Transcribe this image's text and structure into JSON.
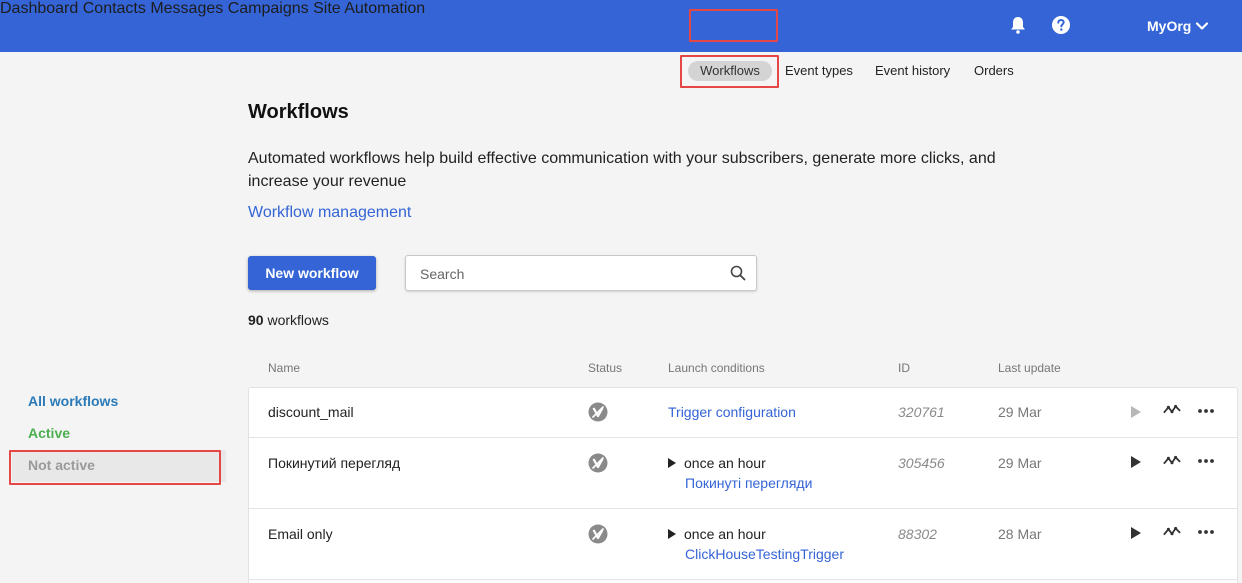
{
  "topnav": {
    "items": [
      {
        "label": "Dashboard"
      },
      {
        "label": "Contacts"
      },
      {
        "label": "Messages"
      },
      {
        "label": "Campaigns"
      },
      {
        "label": "Site"
      },
      {
        "label": "Automation"
      }
    ],
    "org_label": "MyOrg",
    "active_item": "Automation"
  },
  "subtabs": {
    "items": [
      {
        "label": "Workflows"
      },
      {
        "label": "Event types"
      },
      {
        "label": "Event history"
      },
      {
        "label": "Orders"
      }
    ],
    "active_item": "Workflows"
  },
  "page": {
    "title": "Workflows",
    "intro": "Automated workflows help build effective communication with your subscribers, generate more clicks, and increase your revenue",
    "management_link": "Workflow management",
    "new_button": "New workflow",
    "search_placeholder": "Search",
    "count_number": "90",
    "count_label": "workflows"
  },
  "sidebar": {
    "items": [
      {
        "label": "All workflows"
      },
      {
        "label": "Active"
      },
      {
        "label": "Not active"
      }
    ]
  },
  "table": {
    "headers": [
      "Name",
      "Status",
      "Launch conditions",
      "ID",
      "Last update"
    ],
    "rows": [
      {
        "name": "discount_mail",
        "launch": "",
        "launch_link": "Trigger configuration",
        "id": "320761",
        "updated": "29 Mar"
      },
      {
        "name": "Покинутий перегляд",
        "launch": "once an hour",
        "launch_link": "Покинуті перегляди",
        "id": "305456",
        "updated": "29 Mar"
      },
      {
        "name": "Email only",
        "launch": "once an hour",
        "launch_link": "ClickHouseTestingTrigger",
        "id": "88302",
        "updated": "28 Mar"
      }
    ]
  },
  "colors": {
    "brand": "#3464d6",
    "highlight": "#e54646",
    "active_green": "#4caf50",
    "all_blue": "#2a7ab8"
  }
}
